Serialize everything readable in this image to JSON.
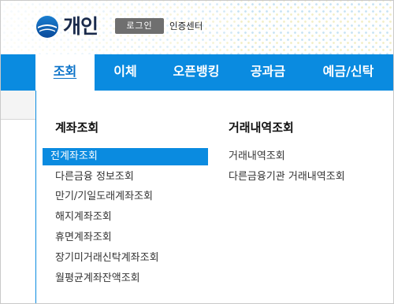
{
  "header": {
    "logo_text": "개인",
    "login_label": "로그인",
    "cert_center_label": "인증센터"
  },
  "nav": {
    "tabs": [
      {
        "label": "조회",
        "active": true
      },
      {
        "label": "이체",
        "active": false
      },
      {
        "label": "오픈뱅킹",
        "active": false
      },
      {
        "label": "공과금",
        "active": false
      },
      {
        "label": "예금/신탁",
        "active": false
      }
    ]
  },
  "dropdown": {
    "account_inquiry": {
      "title": "계좌조회",
      "items": [
        {
          "label": "전계좌조회",
          "selected": true
        },
        {
          "label": "다른금융 정보조회",
          "selected": false
        },
        {
          "label": "만기/기일도래계좌조회",
          "selected": false
        },
        {
          "label": "해지계좌조회",
          "selected": false
        },
        {
          "label": "휴면계좌조회",
          "selected": false
        },
        {
          "label": "장기미거래신탁계좌조회",
          "selected": false
        },
        {
          "label": "월평균계좌잔액조회",
          "selected": false
        }
      ]
    },
    "transaction_inquiry": {
      "title": "거래내역조회",
      "items": [
        {
          "label": "거래내역조회"
        },
        {
          "label": "다른금융기관 거래내역조회"
        }
      ]
    }
  },
  "colors": {
    "nav_blue": "#0a8be0",
    "active_text": "#0a72c8",
    "login_bg": "#6f6f6f"
  }
}
